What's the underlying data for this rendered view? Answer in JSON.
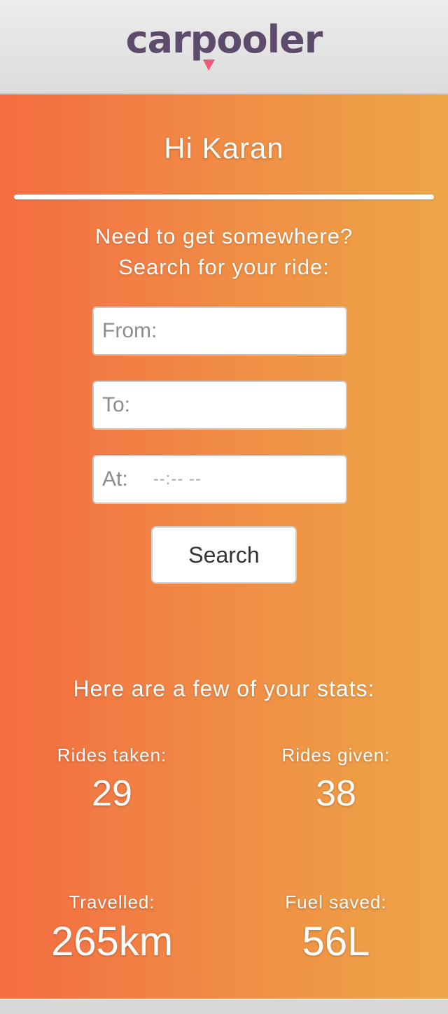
{
  "app": {
    "logo_text": "carpooler"
  },
  "main": {
    "greeting": "Hi Karan",
    "prompt_line1": "Need to get somewhere?",
    "prompt_line2": "Search for your ride:",
    "fields": {
      "from_placeholder": "From:",
      "to_placeholder": "To:",
      "at_label": "At:",
      "at_time_placeholder": "--:-- --"
    },
    "search_label": "Search"
  },
  "stats": {
    "heading": "Here are a few of your stats:",
    "items": [
      {
        "label": "Rides taken:",
        "value": "29"
      },
      {
        "label": "Rides given:",
        "value": "38"
      },
      {
        "label": "Travelled:",
        "value": "265km"
      },
      {
        "label": "Fuel saved:",
        "value": "56L"
      }
    ]
  },
  "colors": {
    "gradient_left": "#f46c42",
    "gradient_right": "#eda647",
    "logo_text": "#5d4b6b",
    "logo_pin": "#f05a78"
  }
}
